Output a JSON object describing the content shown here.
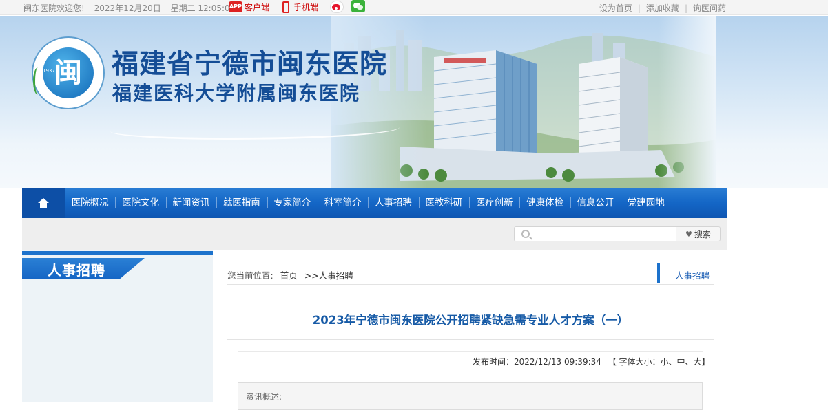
{
  "topbar": {
    "welcome": "闽东医院欢迎您!",
    "date": "2022年12月20日",
    "weekday_time": "星期二 12:05:08",
    "app_badge": "APP",
    "client_label": "客户端",
    "mobile_label": "手机端",
    "right_links": [
      "设为首页",
      "添加收藏",
      "询医问药"
    ],
    "separator": "|"
  },
  "banner": {
    "title_main": "福建省宁德市闽东医院",
    "title_sub": "福建医科大学附属闽东医院",
    "logo_char": "闽",
    "logo_year": "1937"
  },
  "nav": {
    "items": [
      "医院概况",
      "医院文化",
      "新闻资讯",
      "就医指南",
      "专家简介",
      "科室简介",
      "人事招聘",
      "医教科研",
      "医疗创新",
      "健康体检",
      "信息公开",
      "党建园地"
    ]
  },
  "search": {
    "placeholder": "",
    "button_label": "搜索",
    "button_icon": "heart-icon"
  },
  "sidebar": {
    "title": "人事招聘"
  },
  "breadcrumb": {
    "label": "您当前位置:",
    "home": "首页",
    "separator": ">>",
    "current": "人事招聘",
    "category": "人事招聘"
  },
  "article": {
    "title": "2023年宁德市闽东医院公开招聘紧缺急需专业人才方案（一）",
    "publish_label": "发布时间：",
    "publish_time": "2022/12/13 09:39:34",
    "font_size_label": "【 字体大小：小、中、大】",
    "summary_label": "资讯概述:"
  },
  "colors": {
    "nav_blue": "#1466c6",
    "title_blue": "#165aa6",
    "banner_title": "#144d96"
  }
}
